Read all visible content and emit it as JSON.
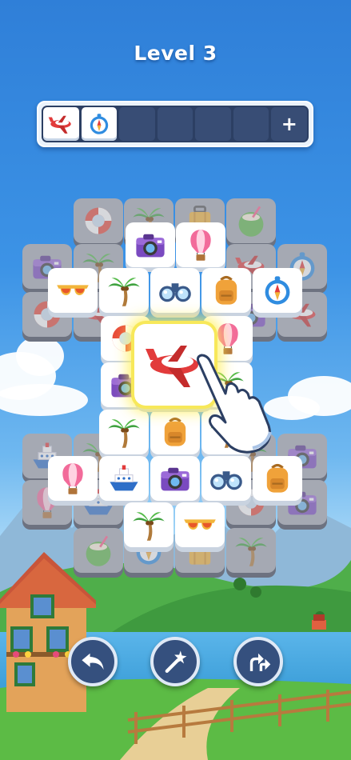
{
  "level": {
    "title": "Level 3"
  },
  "tray": {
    "slots": [
      "airplane",
      "compass",
      "",
      "",
      "",
      "",
      ""
    ],
    "add_label": "+"
  },
  "board": {
    "highlighted_tile": "airplane",
    "tiles_back_row": [
      "life-ring",
      "palm-tree",
      "suitcase",
      "coconut",
      "camera",
      "palm-tree",
      "airplane",
      "compass"
    ],
    "tiles_front_row": [
      "sunglasses",
      "palm-tree",
      "binoculars",
      "backpack",
      "compass"
    ]
  },
  "actions": {
    "undo": "undo-icon",
    "magic": "magic-wand-icon",
    "shuffle": "shuffle-icon"
  },
  "colors": {
    "sky": "#3c93e6",
    "tray": "#2c3f63",
    "button": "#35507e",
    "highlight": "#f7e85a"
  }
}
